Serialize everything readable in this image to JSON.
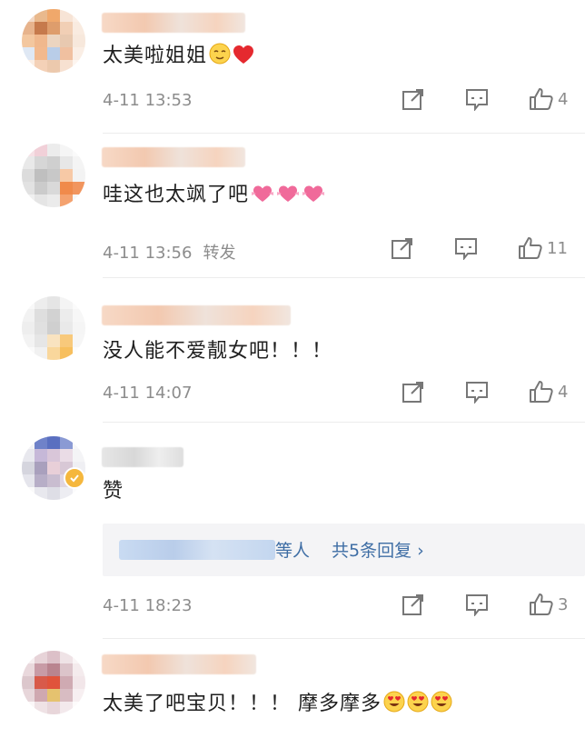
{
  "comments": [
    {
      "text": "太美啦姐姐",
      "time": "4-11 13:53",
      "repost": "",
      "like_count": "4",
      "emojis": [
        "relieved-face",
        "red-heart"
      ]
    },
    {
      "text": "哇这也太飒了吧",
      "time": "4-11 13:56",
      "repost": "转发",
      "like_count": "11",
      "emojis": [
        "heart-bow",
        "heart-bow",
        "heart-bow"
      ]
    },
    {
      "text": "没人能不爱靓女吧！！！",
      "time": "4-11 14:07",
      "repost": "",
      "like_count": "4",
      "emojis": []
    },
    {
      "text": "赞",
      "time": "4-11 18:23",
      "repost": "",
      "like_count": "3",
      "emojis": [],
      "reply": {
        "name_suffix": "等人",
        "link": "共5条回复 ›"
      }
    },
    {
      "text": "太美了吧宝贝！！！ 摩多摩多",
      "time": "",
      "repost": "",
      "like_count": "",
      "emojis": [
        "heart-eyes",
        "heart-eyes",
        "heart-eyes"
      ]
    }
  ],
  "icons": {
    "share": "share-icon",
    "comment": "comment-icon",
    "like": "thumbs-up-icon"
  },
  "colors": {
    "link": "#3f6ea5",
    "meta": "#8c8c8c",
    "verified": "#f5b73d"
  }
}
